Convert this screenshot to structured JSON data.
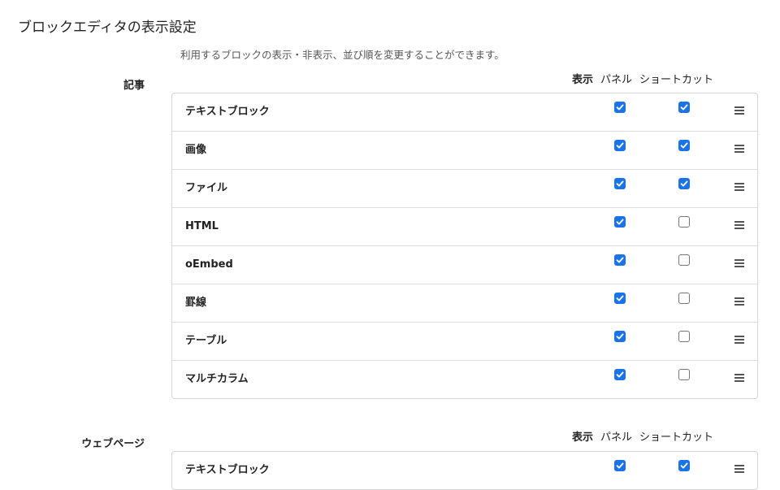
{
  "page": {
    "title": "ブロックエディタの表示設定",
    "description": "利用するブロックの表示・非表示、並び順を変更することができます。"
  },
  "sections": [
    {
      "label": "記事",
      "headers": {
        "show": "表示",
        "panel": "パネル",
        "shortcut": "ショートカット"
      },
      "blocks": [
        {
          "name": "テキストブロック",
          "panel_checked": true,
          "shortcut_checked": true
        },
        {
          "name": "画像",
          "panel_checked": true,
          "shortcut_checked": true
        },
        {
          "name": "ファイル",
          "panel_checked": true,
          "shortcut_checked": true
        },
        {
          "name": "HTML",
          "panel_checked": true,
          "shortcut_checked": false
        },
        {
          "name": "oEmbed",
          "panel_checked": true,
          "shortcut_checked": false
        },
        {
          "name": "罫線",
          "panel_checked": true,
          "shortcut_checked": false
        },
        {
          "name": "テーブル",
          "panel_checked": true,
          "shortcut_checked": false
        },
        {
          "name": "マルチカラム",
          "panel_checked": true,
          "shortcut_checked": false
        }
      ]
    },
    {
      "label": "ウェブページ",
      "headers": {
        "show": "表示",
        "panel": "パネル",
        "shortcut": "ショートカット"
      },
      "blocks": [
        {
          "name": "テキストブロック",
          "panel_checked": true,
          "shortcut_checked": true
        }
      ]
    }
  ],
  "colors": {
    "checkbox_checked": "#1a73e8",
    "text": "#222222",
    "border": "#d6d6d6"
  },
  "icons": {
    "checked": "checkbox-checked-icon",
    "unchecked": "checkbox-unchecked-icon",
    "drag": "drag-handle-icon"
  }
}
